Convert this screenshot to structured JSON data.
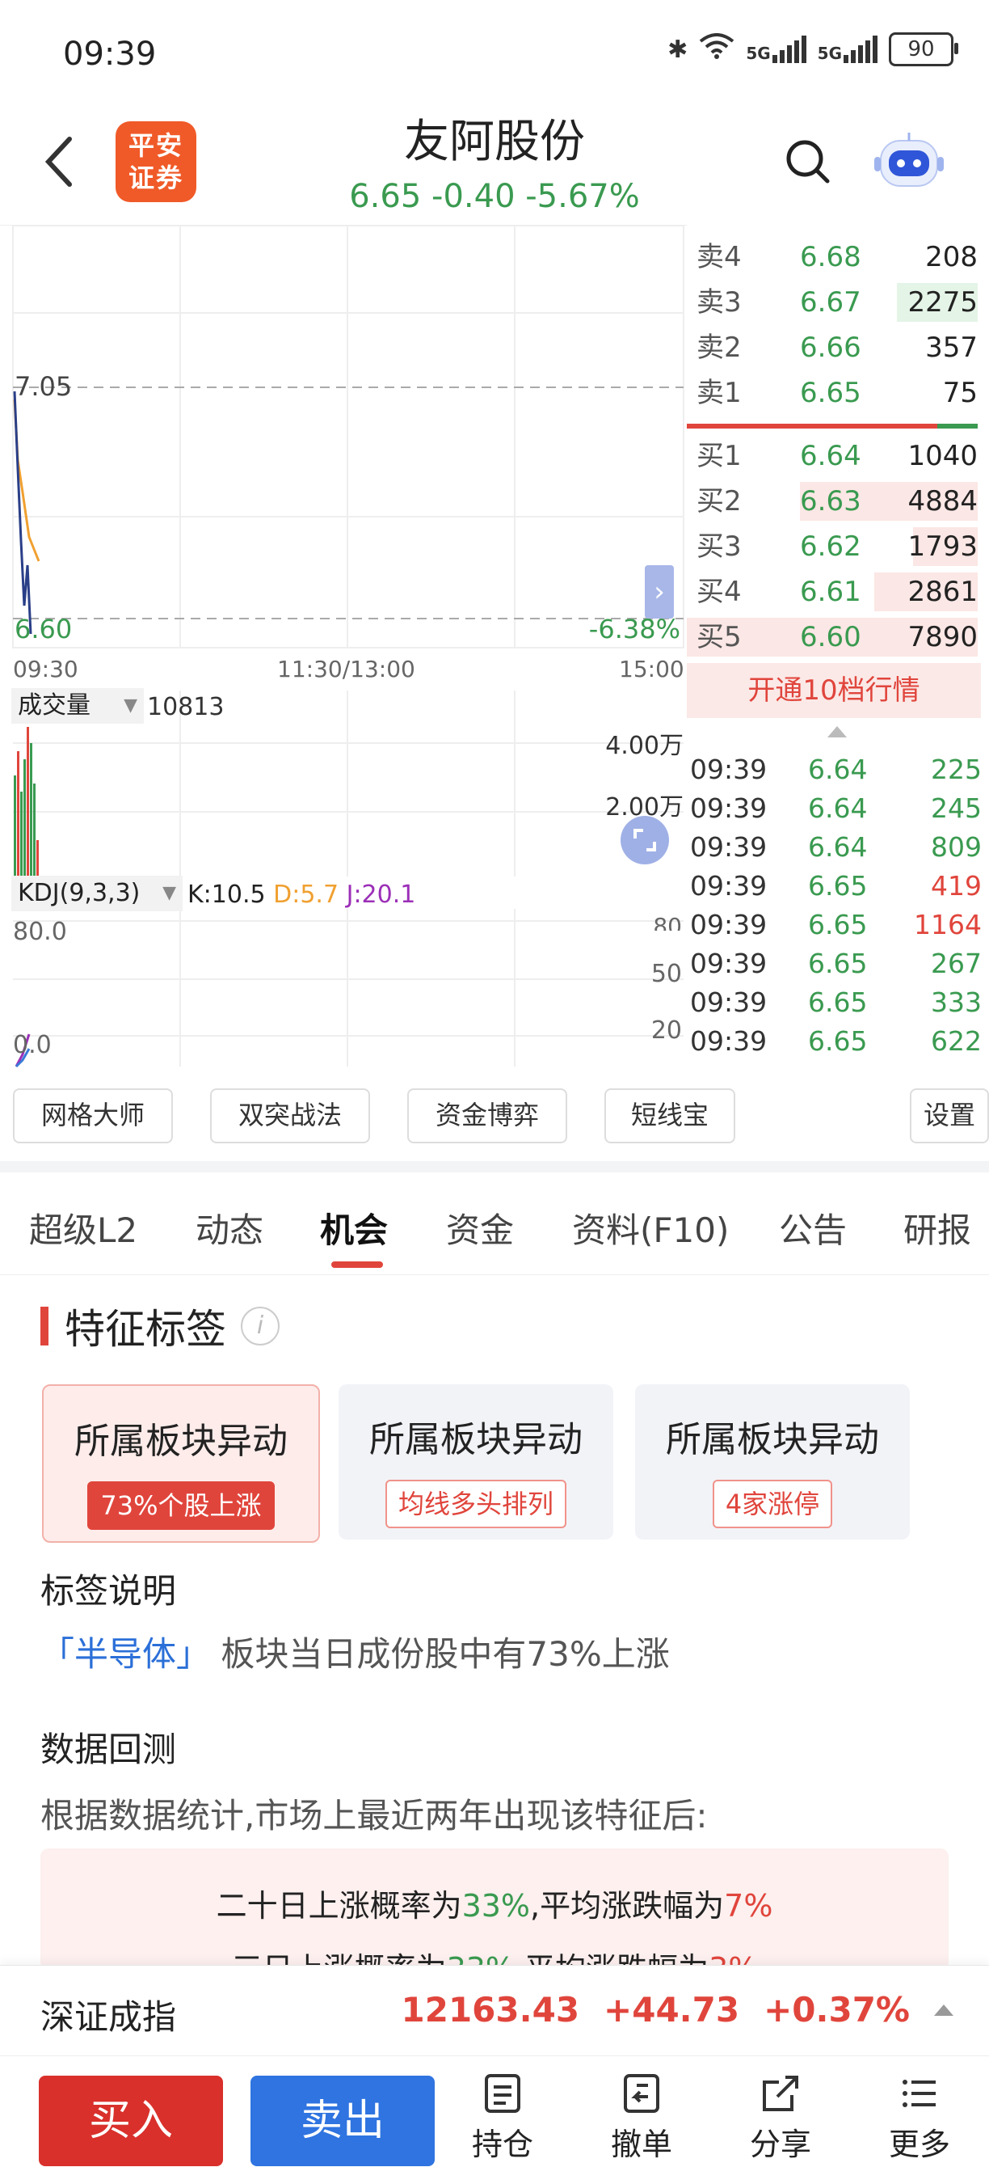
{
  "status_bar": {
    "time": "09:39",
    "battery": "90",
    "net1": "5G",
    "net2": "5G"
  },
  "header": {
    "broker_logo": "平安证券",
    "stock_name": "友阿股份",
    "price": "6.65",
    "change": "-0.40",
    "change_pct": "-5.67%"
  },
  "chart": {
    "price_high_label": "7.05",
    "price_low_label": "6.60",
    "pct_low_label": "-6.38%",
    "time_start": "09:30",
    "time_mid": "11:30/13:00",
    "time_end": "15:00",
    "volume_indicator": "成交量",
    "volume_value": "10813",
    "vol_axis_top": "4.00万",
    "vol_axis_mid": "2.00万",
    "kdj_label": "KDJ(9,3,3)",
    "kdj_k": "K:10.5",
    "kdj_d": "D:5.7",
    "kdj_j": "J:20.1",
    "kdj_80_left": "80.0",
    "kdj_80_right": "80",
    "kdj_50": "50",
    "kdj_20": "20",
    "kdj_zero": "0.0"
  },
  "order_book": {
    "asks": [
      {
        "label": "卖4",
        "price": "6.68",
        "volume": "208"
      },
      {
        "label": "卖3",
        "price": "6.67",
        "volume": "2275"
      },
      {
        "label": "卖2",
        "price": "6.66",
        "volume": "357"
      },
      {
        "label": "卖1",
        "price": "6.65",
        "volume": "75"
      }
    ],
    "bids": [
      {
        "label": "买1",
        "price": "6.64",
        "volume": "1040"
      },
      {
        "label": "买2",
        "price": "6.63",
        "volume": "4884"
      },
      {
        "label": "买3",
        "price": "6.62",
        "volume": "1793"
      },
      {
        "label": "买4",
        "price": "6.61",
        "volume": "2861"
      },
      {
        "label": "买5",
        "price": "6.60",
        "volume": "7890"
      }
    ],
    "open_10_label": "开通10档行情"
  },
  "ticks": [
    {
      "time": "09:39",
      "price": "6.64",
      "volume": "225"
    },
    {
      "time": "09:39",
      "price": "6.64",
      "volume": "245"
    },
    {
      "time": "09:39",
      "price": "6.64",
      "volume": "809"
    },
    {
      "time": "09:39",
      "price": "6.65",
      "volume": "419"
    },
    {
      "time": "09:39",
      "price": "6.65",
      "volume": "1164"
    },
    {
      "time": "09:39",
      "price": "6.65",
      "volume": "267"
    },
    {
      "time": "09:39",
      "price": "6.65",
      "volume": "333"
    },
    {
      "time": "09:39",
      "price": "6.65",
      "volume": "622"
    }
  ],
  "tools": [
    "网格大师",
    "双突战法",
    "资金博弈",
    "短线宝",
    "设置"
  ],
  "tabs": [
    "超级L2",
    "动态",
    "机会",
    "资金",
    "资料(F10)",
    "公告",
    "研报"
  ],
  "feature": {
    "title": "特征标签",
    "cards": [
      {
        "title": "所属板块异动",
        "chip": "73%个股上涨"
      },
      {
        "title": "所属板块异动",
        "chip": "均线多头排列"
      },
      {
        "title": "所属板块异动",
        "chip": "4家涨停"
      }
    ],
    "desc_head": "标签说明",
    "desc_sector": "「半导体」",
    "desc_text": "板块当日成份股中有73%上涨",
    "backtest_head": "数据回测",
    "backtest_desc": "根据数据统计,市场上最近两年出现该特征后:",
    "line1_a": "二十日上涨概率为",
    "line1_b": "33%",
    "line1_c": ",平均涨跌幅为",
    "line1_d": "7%",
    "line2_a": "三日上涨概率为",
    "line2_b": "33%",
    "line2_c": ",平均涨跌幅为",
    "line2_d": "3%"
  },
  "index_bar": {
    "name": "深证成指",
    "value": "12163.43",
    "change": "+44.73",
    "change_pct": "+0.37%"
  },
  "bottom_bar": {
    "buy": "买入",
    "sell": "卖出",
    "positions": "持仓",
    "cancel": "撤单",
    "share": "分享",
    "more": "更多"
  },
  "colors": {
    "up": "#e0453c",
    "down": "#3a9a50",
    "buy": "#d9302b",
    "sell": "#2f74e0"
  }
}
